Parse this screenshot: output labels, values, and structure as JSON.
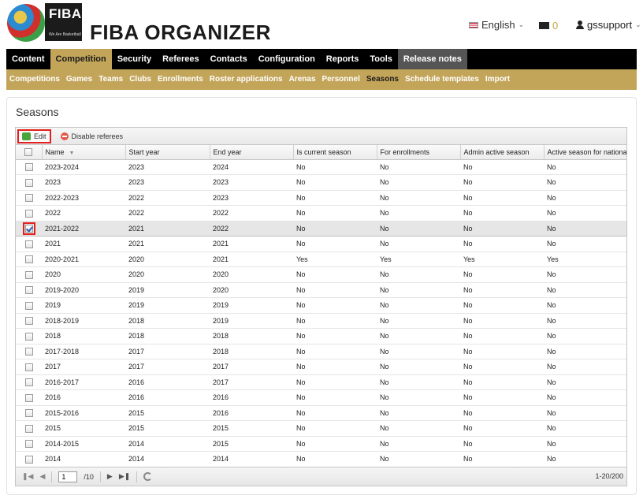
{
  "header": {
    "logo_text": "FIBA",
    "logo_tagline": "We Are Basketball",
    "app_title": "FIBA ORGANIZER",
    "language": "English",
    "mail_count": "0",
    "username": "gssupport"
  },
  "main_nav": [
    "Content",
    "Competition",
    "Security",
    "Referees",
    "Contacts",
    "Configuration",
    "Reports",
    "Tools",
    "Release notes"
  ],
  "main_nav_active": "Competition",
  "sub_nav": [
    "Competitions",
    "Games",
    "Teams",
    "Clubs",
    "Enrollments",
    "Roster applications",
    "Arenas",
    "Personnel",
    "Seasons",
    "Schedule templates",
    "Import"
  ],
  "sub_nav_active": "Seasons",
  "page_title": "Seasons",
  "toolbar": {
    "edit_label": "Edit",
    "disable_label": "Disable referees"
  },
  "columns": [
    "Name",
    "Start year",
    "End year",
    "Is current season",
    "For enrollments",
    "Admin active season",
    "Active season for national"
  ],
  "rows": [
    {
      "name": "2023-2024",
      "start": "2023",
      "end": "2024",
      "current": "No",
      "enroll": "No",
      "admin": "No",
      "national": "No",
      "checked": false
    },
    {
      "name": "2023",
      "start": "2023",
      "end": "2023",
      "current": "No",
      "enroll": "No",
      "admin": "No",
      "national": "No",
      "checked": false
    },
    {
      "name": "2022-2023",
      "start": "2022",
      "end": "2023",
      "current": "No",
      "enroll": "No",
      "admin": "No",
      "national": "No",
      "checked": false
    },
    {
      "name": "2022",
      "start": "2022",
      "end": "2022",
      "current": "No",
      "enroll": "No",
      "admin": "No",
      "national": "No",
      "checked": false
    },
    {
      "name": "2021-2022",
      "start": "2021",
      "end": "2022",
      "current": "No",
      "enroll": "No",
      "admin": "No",
      "national": "No",
      "checked": true
    },
    {
      "name": "2021",
      "start": "2021",
      "end": "2021",
      "current": "No",
      "enroll": "No",
      "admin": "No",
      "national": "No",
      "checked": false
    },
    {
      "name": "2020-2021",
      "start": "2020",
      "end": "2021",
      "current": "Yes",
      "enroll": "Yes",
      "admin": "Yes",
      "national": "Yes",
      "checked": false
    },
    {
      "name": "2020",
      "start": "2020",
      "end": "2020",
      "current": "No",
      "enroll": "No",
      "admin": "No",
      "national": "No",
      "checked": false
    },
    {
      "name": "2019-2020",
      "start": "2019",
      "end": "2020",
      "current": "No",
      "enroll": "No",
      "admin": "No",
      "national": "No",
      "checked": false
    },
    {
      "name": "2019",
      "start": "2019",
      "end": "2019",
      "current": "No",
      "enroll": "No",
      "admin": "No",
      "national": "No",
      "checked": false
    },
    {
      "name": "2018-2019",
      "start": "2018",
      "end": "2019",
      "current": "No",
      "enroll": "No",
      "admin": "No",
      "national": "No",
      "checked": false
    },
    {
      "name": "2018",
      "start": "2018",
      "end": "2018",
      "current": "No",
      "enroll": "No",
      "admin": "No",
      "national": "No",
      "checked": false
    },
    {
      "name": "2017-2018",
      "start": "2017",
      "end": "2018",
      "current": "No",
      "enroll": "No",
      "admin": "No",
      "national": "No",
      "checked": false
    },
    {
      "name": "2017",
      "start": "2017",
      "end": "2017",
      "current": "No",
      "enroll": "No",
      "admin": "No",
      "national": "No",
      "checked": false
    },
    {
      "name": "2016-2017",
      "start": "2016",
      "end": "2017",
      "current": "No",
      "enroll": "No",
      "admin": "No",
      "national": "No",
      "checked": false
    },
    {
      "name": "2016",
      "start": "2016",
      "end": "2016",
      "current": "No",
      "enroll": "No",
      "admin": "No",
      "national": "No",
      "checked": false
    },
    {
      "name": "2015-2016",
      "start": "2015",
      "end": "2016",
      "current": "No",
      "enroll": "No",
      "admin": "No",
      "national": "No",
      "checked": false
    },
    {
      "name": "2015",
      "start": "2015",
      "end": "2015",
      "current": "No",
      "enroll": "No",
      "admin": "No",
      "national": "No",
      "checked": false
    },
    {
      "name": "2014-2015",
      "start": "2014",
      "end": "2015",
      "current": "No",
      "enroll": "No",
      "admin": "No",
      "national": "No",
      "checked": false
    },
    {
      "name": "2014",
      "start": "2014",
      "end": "2014",
      "current": "No",
      "enroll": "No",
      "admin": "No",
      "national": "No",
      "checked": false
    }
  ],
  "pager": {
    "page": "1",
    "total_pages": "/10",
    "range": "1-20/200"
  },
  "colors": {
    "gold": "#c3a55a",
    "nav_bg": "#000000",
    "highlight": "#e41f1f"
  }
}
